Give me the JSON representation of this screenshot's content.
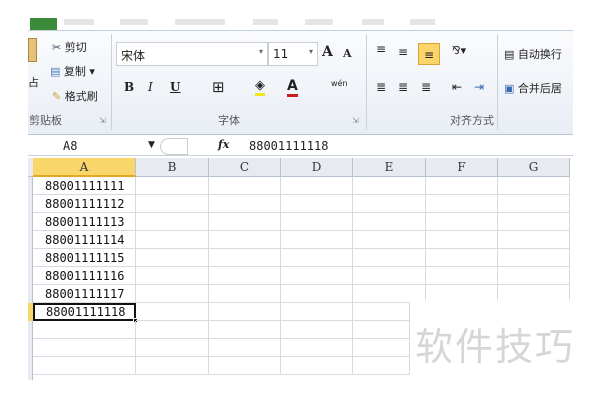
{
  "ribbon": {
    "clipboard": {
      "cut": "剪切",
      "copy": "复制",
      "format_painter": "格式刷",
      "paste_partial": "占",
      "group_label": "剪贴板"
    },
    "font": {
      "font_name": "宋体",
      "font_size": "11",
      "bold": "B",
      "italic": "I",
      "underline": "U",
      "font_color_glyph": "A",
      "grow": "A",
      "shrink": "A",
      "phonetic": "wén",
      "group_label": "字体"
    },
    "alignment": {
      "wrap_text": "自动换行",
      "merge_center": "合并后居",
      "group_label": "对齐方式"
    }
  },
  "formula_bar": {
    "name_box": "A8",
    "fx": "fx",
    "value": "88001111118"
  },
  "columns": [
    "A",
    "B",
    "C",
    "D",
    "E",
    "F",
    "G"
  ],
  "selected_column": "A",
  "cells": [
    "88001111111",
    "88001111112",
    "88001111113",
    "88001111114",
    "88001111115",
    "88001111116",
    "88001111117",
    "88001111118"
  ],
  "active_cell": "A8",
  "watermark": "软件技巧"
}
